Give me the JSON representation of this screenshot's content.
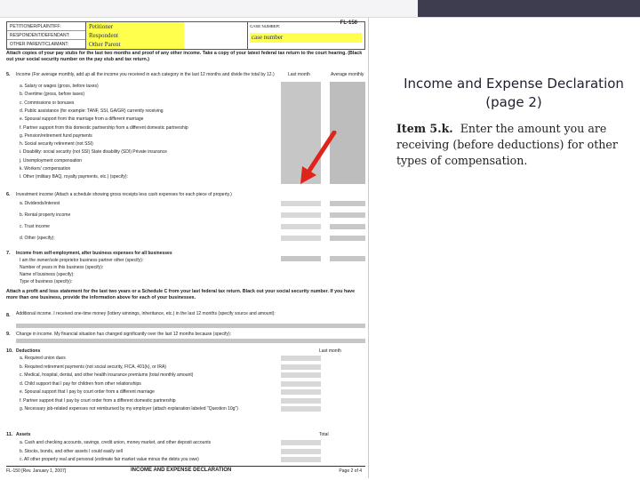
{
  "slide": {
    "title": "Income and Expense Declaration (page 2)",
    "item_label": "Item 5.k.",
    "item_text": "Enter the amount you are receiving (before deductions) for other types of compensation."
  },
  "form": {
    "form_number": "FL-150",
    "header": {
      "party_labels": [
        "PETITIONER/PLAINTIFF:",
        "RESPONDENT/DEFENDANT:",
        "OTHER PARENT/CLAIMANT:"
      ],
      "party_values": [
        "Petitioner",
        "Respondent",
        "Other Parent"
      ],
      "case_number_label": "CASE NUMBER:",
      "case_number_value": "case number"
    },
    "attach_instructions": "Attach copies of your pay stubs for the last two months and proof of any other income. Take a copy of your latest federal tax return to the court hearing. (Black out your social security number on the pay stub and tax return.)",
    "section5": {
      "num": "5.",
      "label": "Income (For average monthly, add up all the income you received in each category in the last 12 months and divide the total by 12.)",
      "col_last": "Last month",
      "col_avg": "Average monthly",
      "rows": [
        "a. Salary or wages (gross, before taxes)",
        "b. Overtime (gross, before taxes)",
        "c. Commissions or bonuses",
        "d. Public assistance (for example: TANF, SSI, GA/GR)   currently receiving",
        "e. Spousal support   from this marriage   from a different marriage",
        "f. Partner support   from this domestic partnership   from a different domestic partnership",
        "g. Pension/retirement fund payments",
        "h. Social security retirement (not SSI)",
        "i. Disability:   social security (not SSI)   State disability (SDI)   Private insurance",
        "j. Unemployment compensation",
        "k. Workers' compensation",
        "l. Other (military BAQ, royalty payments, etc.) (specify):"
      ]
    },
    "section6": {
      "num": "6.",
      "label": "Investment income (Attach a schedule showing gross receipts less cash expenses for each piece of property.)",
      "rows": [
        "a. Dividends/interest",
        "b. Rental property income",
        "c. Trust income",
        "d. Other (specify):"
      ]
    },
    "section7": {
      "num": "7.",
      "label": "Income from self-employment, after business expenses for all businesses",
      "rows": [
        "I am the   owner/sole proprietor   business partner   other (specify):",
        "Number of years in this business (specify):",
        "Name of business (specify):",
        "Type of business (specify):"
      ],
      "attach_text": "Attach a profit and loss statement for the last two years or a Schedule C from your last federal tax return. Black out your social security number. If you have more than one business, provide the information above for each of your businesses."
    },
    "section8": {
      "num": "8.",
      "label": "Additional income. I received one-time money (lottery winnings, inheritance, etc.) in the last 12 months (specify source and amount):"
    },
    "section9": {
      "num": "9.",
      "label": "Change in income. My financial situation has changed significantly over the last 12 months because (specify):"
    },
    "section10": {
      "num": "10.",
      "label": "Deductions",
      "col": "Last month",
      "rows": [
        "a. Required union dues",
        "b. Required retirement payments (not social security, FICA, 401(k), or IRA)",
        "c. Medical, hospital, dental, and other health insurance premiums (total monthly amount)",
        "d. Child support that I pay for children from other relationships",
        "e. Spousal support that I pay by court order from a different marriage",
        "f. Partner support that I pay by court order from a different domestic partnership",
        "g. Necessary job-related expenses not reimbursed by my employer (attach explanation labeled \"Question 10g\")"
      ]
    },
    "section11": {
      "num": "11.",
      "label": "Assets",
      "col": "Total",
      "rows": [
        "a. Cash and checking accounts, savings, credit union, money market, and other deposit accounts",
        "b. Stocks, bonds, and other assets I could easily sell",
        "c. All other property   real and   personal (estimate fair market value minus the debts you owe)"
      ]
    },
    "footer": {
      "left": "FL-150 [Rev. January 1, 2007]",
      "center": "INCOME AND EXPENSE DECLARATION",
      "right": "Page 2 of 4"
    }
  },
  "colors": {
    "highlight": "#ffff4d",
    "arrow": "#e0231b",
    "topbar_dark": "#3d3d4f"
  }
}
